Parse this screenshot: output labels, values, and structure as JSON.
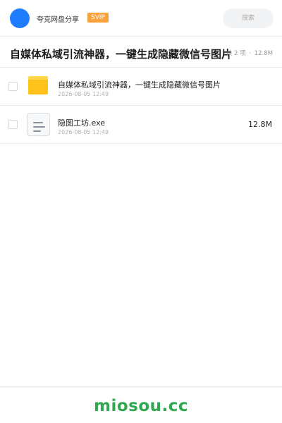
{
  "header": {
    "user_name": "夸克网盘分享",
    "badge": "SVIP",
    "search_placeholder": "搜索"
  },
  "share": {
    "title": "自媒体私域引流神器，一键生成隐藏微信号图片",
    "count_label": "共 2 项",
    "separator": "·",
    "total_size": "12.8M"
  },
  "files": [
    {
      "name": "自媒体私域引流神器，一键生成隐藏微信号图片",
      "date": "2026-08-05 12:49",
      "size": "",
      "icon": "folder-icon"
    },
    {
      "name": "隐图工坊.exe",
      "date": "2026-08-05 12:49",
      "size": "12.8M",
      "icon": "file-icon"
    }
  ],
  "footer": {
    "watermark": "miosou.cc"
  },
  "colors": {
    "avatar": "#1f7cff",
    "badge": "#f7a23b",
    "folder": "#ffc21a",
    "watermark": "#2fa84f"
  }
}
